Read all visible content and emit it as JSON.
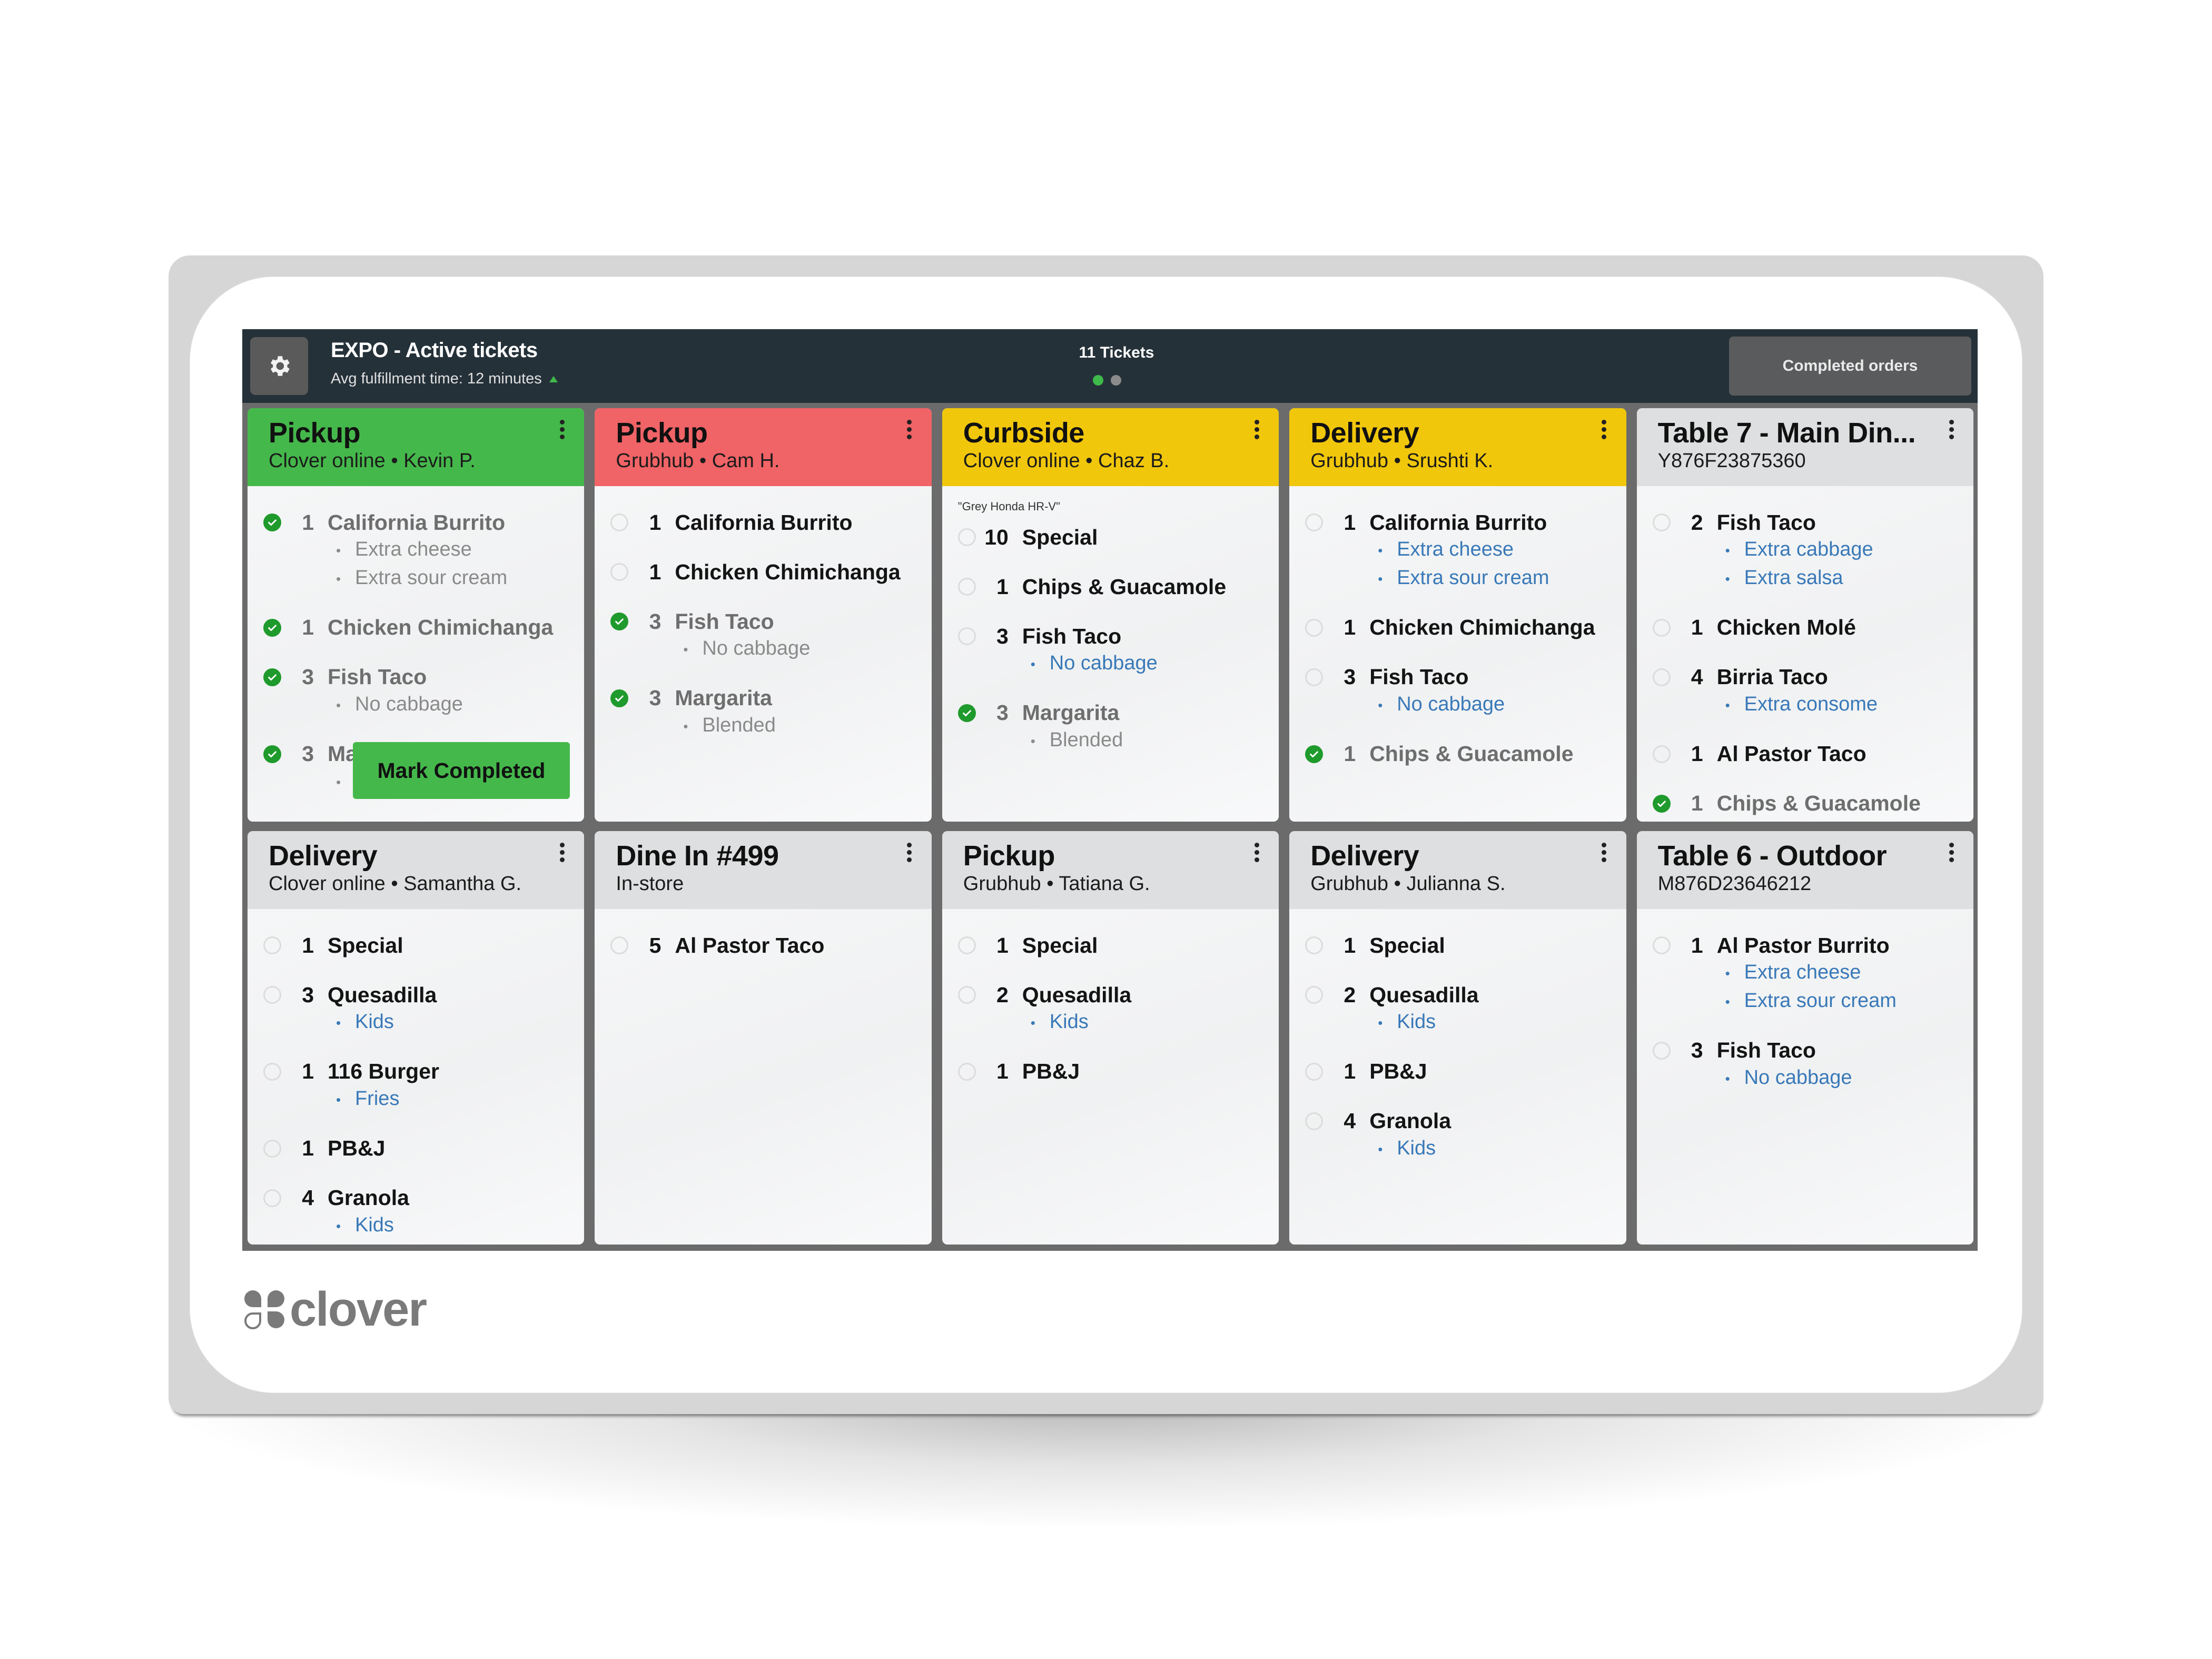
{
  "header": {
    "title": "EXPO - Active tickets",
    "subtitle": "Avg fulfillment time: 12 minutes",
    "trend": "up",
    "ticket_count": "11 Tickets",
    "page_indicator": {
      "pages": 2,
      "current": 1
    },
    "completed_orders_label": "Completed orders",
    "settings_icon": "gear-icon"
  },
  "colors": {
    "header_bg": "#253139",
    "green": "#45b84b",
    "red": "#f06366",
    "yellow": "#f1c70b",
    "neutral_header": "#dedfe0",
    "modifier_blue": "#3979b8",
    "check_green": "#1f9a2c"
  },
  "tickets": [
    {
      "title": "Pickup",
      "subtitle": "Clover online •  Kevin P.",
      "status_color": "green",
      "items": [
        {
          "qty": "1",
          "name": "California Burrito",
          "done": true,
          "mods": [
            "Extra cheese",
            "Extra sour cream"
          ]
        },
        {
          "qty": "1",
          "name": "Chicken Chimichanga",
          "done": true,
          "mods": []
        },
        {
          "qty": "3",
          "name": "Fish Taco",
          "done": true,
          "mods": [
            "No cabbage"
          ]
        },
        {
          "qty": "3",
          "name": "Margarita",
          "done": true,
          "mods": [
            ""
          ]
        }
      ],
      "action_label": "Mark Completed"
    },
    {
      "title": "Pickup",
      "subtitle": "Grubhub •  Cam H.",
      "status_color": "red",
      "items": [
        {
          "qty": "1",
          "name": "California Burrito",
          "done": false,
          "mods": []
        },
        {
          "qty": "1",
          "name": "Chicken Chimichanga",
          "done": false,
          "mods": []
        },
        {
          "qty": "3",
          "name": "Fish Taco",
          "done": true,
          "mods": [
            "No cabbage"
          ]
        },
        {
          "qty": "3",
          "name": "Margarita",
          "done": true,
          "mods": [
            "Blended"
          ]
        }
      ]
    },
    {
      "title": "Curbside",
      "subtitle": "Clover online •  Chaz B.",
      "status_color": "yellow",
      "note": "\"Grey Honda HR-V\"",
      "items": [
        {
          "qty": "10",
          "name": "Special",
          "done": false,
          "mods": []
        },
        {
          "qty": "1",
          "name": "Chips & Guacamole",
          "done": false,
          "mods": []
        },
        {
          "qty": "3",
          "name": "Fish Taco",
          "done": false,
          "mods": [
            "No cabbage"
          ]
        },
        {
          "qty": "3",
          "name": "Margarita",
          "done": true,
          "mods": [
            "Blended"
          ]
        }
      ]
    },
    {
      "title": "Delivery",
      "subtitle": "Grubhub •  Srushti K.",
      "status_color": "yellow",
      "items": [
        {
          "qty": "1",
          "name": "California Burrito",
          "done": false,
          "mods": [
            "Extra cheese",
            "Extra sour cream"
          ]
        },
        {
          "qty": "1",
          "name": "Chicken Chimichanga",
          "done": false,
          "mods": []
        },
        {
          "qty": "3",
          "name": "Fish Taco",
          "done": false,
          "mods": [
            "No cabbage"
          ]
        },
        {
          "qty": "1",
          "name": "Chips & Guacamole",
          "done": true,
          "mods": []
        }
      ]
    },
    {
      "title": "Table 7 - Main Din...",
      "subtitle": "Y876F23875360",
      "status_color": "neutral",
      "items": [
        {
          "qty": "2",
          "name": "Fish Taco",
          "done": false,
          "mods": [
            "Extra cabbage",
            "Extra salsa"
          ]
        },
        {
          "qty": "1",
          "name": "Chicken Molé",
          "done": false,
          "mods": []
        },
        {
          "qty": "4",
          "name": "Birria Taco",
          "done": false,
          "mods": [
            "Extra consome"
          ]
        },
        {
          "qty": "1",
          "name": "Al Pastor Taco",
          "done": false,
          "mods": []
        },
        {
          "qty": "1",
          "name": "Chips & Guacamole",
          "done": true,
          "mods": []
        }
      ]
    },
    {
      "title": "Delivery",
      "subtitle": "Clover online •  Samantha G.",
      "status_color": "neutral",
      "items": [
        {
          "qty": "1",
          "name": "Special",
          "done": false,
          "mods": []
        },
        {
          "qty": "3",
          "name": "Quesadilla",
          "done": false,
          "mods": [
            "Kids"
          ]
        },
        {
          "qty": "1",
          "name": "116 Burger",
          "done": false,
          "mods": [
            "Fries"
          ]
        },
        {
          "qty": "1",
          "name": "PB&J",
          "done": false,
          "mods": []
        },
        {
          "qty": "4",
          "name": "Granola",
          "done": false,
          "mods": [
            "Kids"
          ]
        }
      ]
    },
    {
      "title": "Dine In #499",
      "subtitle": "In-store",
      "status_color": "neutral",
      "items": [
        {
          "qty": "5",
          "name": "Al Pastor Taco",
          "done": false,
          "mods": []
        }
      ]
    },
    {
      "title": "Pickup",
      "subtitle": "Grubhub •  Tatiana G.",
      "status_color": "neutral",
      "items": [
        {
          "qty": "1",
          "name": "Special",
          "done": false,
          "mods": []
        },
        {
          "qty": "2",
          "name": "Quesadilla",
          "done": false,
          "mods": [
            "Kids"
          ]
        },
        {
          "qty": "1",
          "name": "PB&J",
          "done": false,
          "mods": []
        }
      ]
    },
    {
      "title": "Delivery",
      "subtitle": "Grubhub •  Julianna S.",
      "status_color": "neutral",
      "items": [
        {
          "qty": "1",
          "name": "Special",
          "done": false,
          "mods": []
        },
        {
          "qty": "2",
          "name": "Quesadilla",
          "done": false,
          "mods": [
            "Kids"
          ]
        },
        {
          "qty": "1",
          "name": "PB&J",
          "done": false,
          "mods": []
        },
        {
          "qty": "4",
          "name": "Granola",
          "done": false,
          "mods": [
            "Kids"
          ]
        }
      ]
    },
    {
      "title": "Table 6 - Outdoor",
      "subtitle": "M876D23646212",
      "status_color": "neutral",
      "items": [
        {
          "qty": "1",
          "name": "Al Pastor Burrito",
          "done": false,
          "mods": [
            "Extra cheese",
            "Extra sour cream"
          ]
        },
        {
          "qty": "3",
          "name": "Fish Taco",
          "done": false,
          "mods": [
            "No cabbage"
          ]
        }
      ]
    }
  ],
  "brand": {
    "name": "clover",
    "icon": "clover-logo-icon"
  }
}
